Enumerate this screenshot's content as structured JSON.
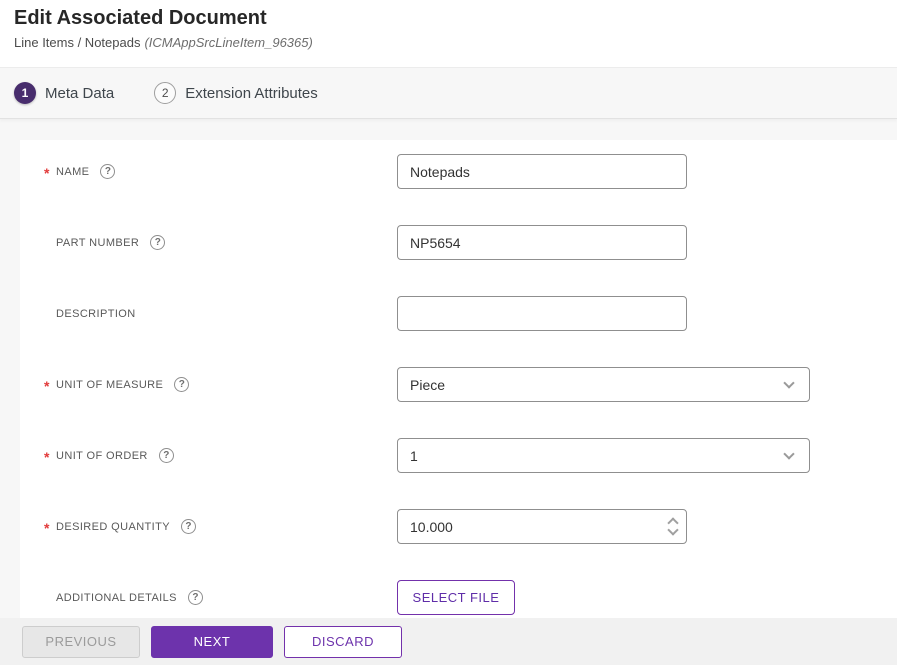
{
  "header": {
    "title": "Edit Associated Document",
    "breadcrumb": "Line Items / Notepads",
    "breadcrumb_ref": "(ICMAppSrcLineItem_96365)"
  },
  "stepper": {
    "steps": [
      {
        "number": "1",
        "label": "Meta Data",
        "active": true
      },
      {
        "number": "2",
        "label": "Extension Attributes",
        "active": false
      }
    ]
  },
  "form": {
    "fields": [
      {
        "label": "NAME",
        "marker": "*",
        "required": true,
        "has_help": true,
        "type": "text",
        "value": "Notepads"
      },
      {
        "label": "PART NUMBER",
        "marker": "",
        "required": false,
        "has_help": true,
        "type": "text",
        "value": "NP5654"
      },
      {
        "label": "DESCRIPTION",
        "marker": "",
        "required": false,
        "has_help": false,
        "type": "text",
        "value": ""
      },
      {
        "label": "UNIT OF MEASURE",
        "marker": "*",
        "required": true,
        "has_help": true,
        "type": "select",
        "value": "Piece"
      },
      {
        "label": "UNIT OF ORDER",
        "marker": "*",
        "required": true,
        "has_help": true,
        "type": "select",
        "value": "1"
      },
      {
        "label": "DESIRED QUANTITY",
        "marker": "*",
        "required": true,
        "has_help": true,
        "type": "number",
        "value": "10.000"
      },
      {
        "label": "ADDITIONAL DETAILS",
        "marker": "",
        "required": false,
        "has_help": true,
        "type": "file",
        "button_label": "SELECT FILE"
      }
    ],
    "help_glyph": "?"
  },
  "footer": {
    "previous_label": "PREVIOUS",
    "next_label": "NEXT",
    "discard_label": "DISCARD"
  },
  "colors": {
    "accent_purple": "#6d33ac",
    "step_active_purple": "#482d6d",
    "required_red": "#e23b3b",
    "footer_bg": "#f1f1f1",
    "stepper_bg": "#f7f7f7"
  }
}
